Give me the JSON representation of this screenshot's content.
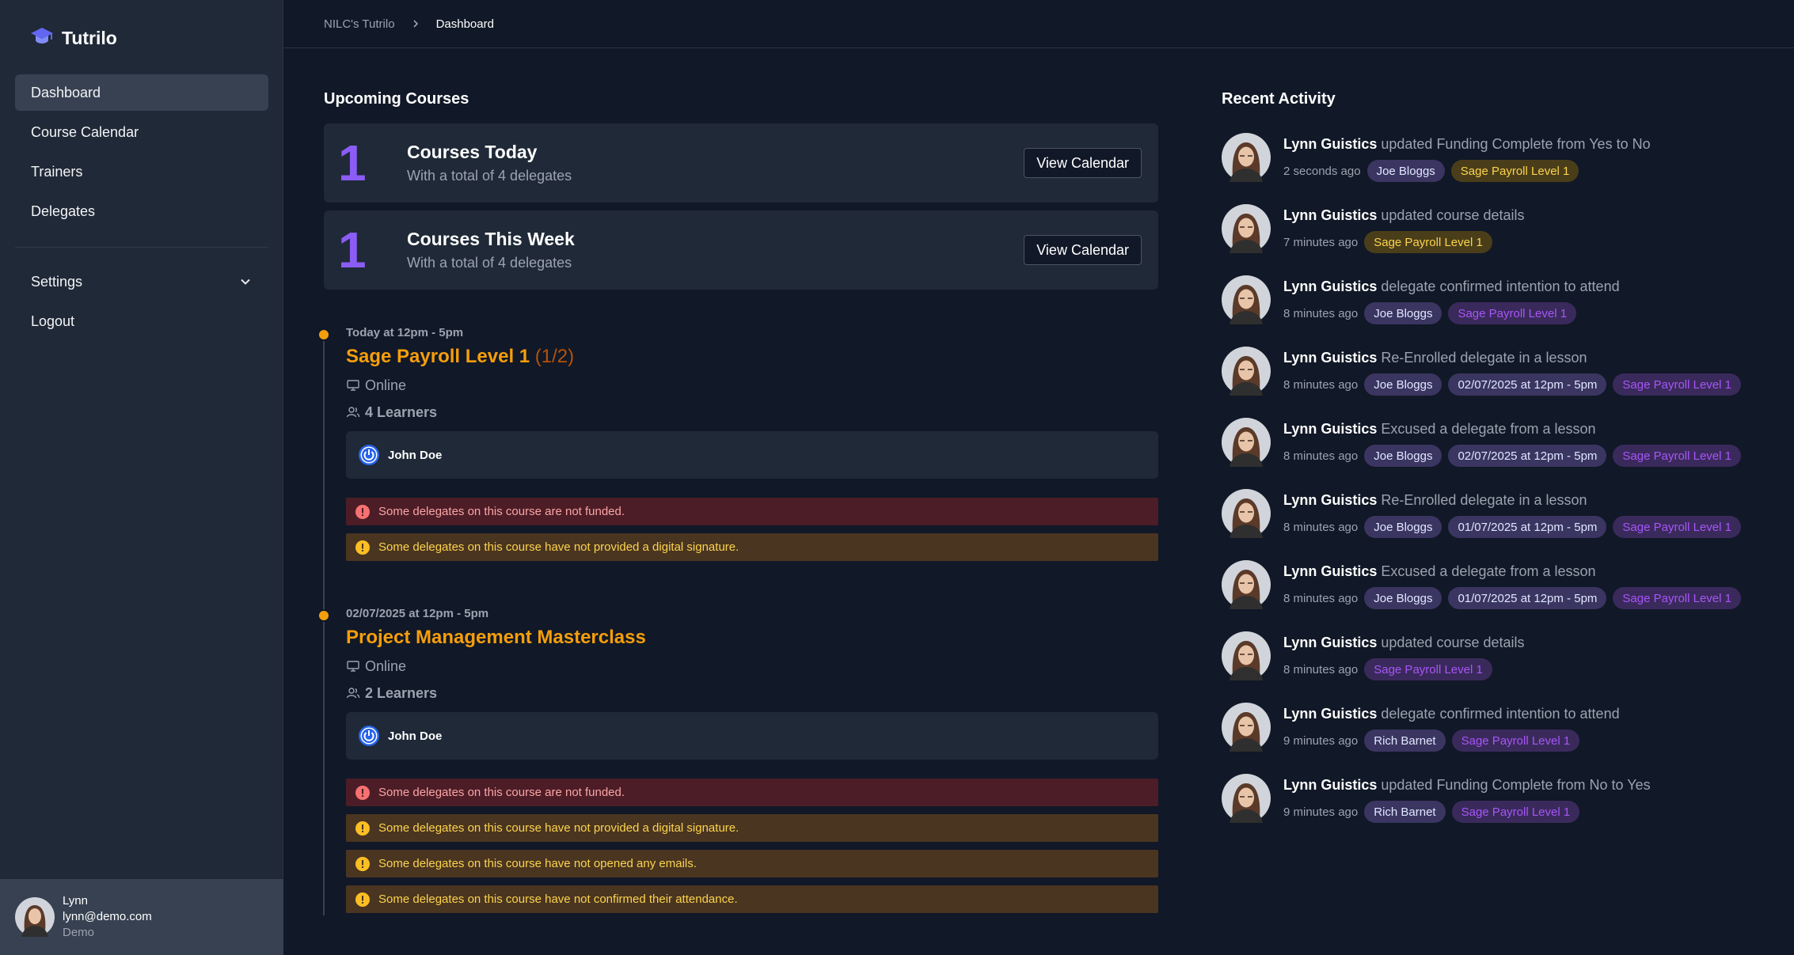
{
  "app": {
    "name": "Tutrilo"
  },
  "sidebar": {
    "items": [
      {
        "label": "Dashboard",
        "active": true
      },
      {
        "label": "Course Calendar"
      },
      {
        "label": "Trainers"
      },
      {
        "label": "Delegates"
      }
    ],
    "settings_label": "Settings",
    "logout_label": "Logout",
    "user": {
      "name": "Lynn",
      "email": "lynn@demo.com",
      "org": "Demo"
    }
  },
  "breadcrumb": {
    "root": "NILC's Tutrilo",
    "current": "Dashboard"
  },
  "upcoming": {
    "title": "Upcoming Courses",
    "cards": [
      {
        "count": "1",
        "title": "Courses Today",
        "subtitle": "With a total of 4 delegates",
        "button": "View Calendar"
      },
      {
        "count": "1",
        "title": "Courses This Week",
        "subtitle": "With a total of 4 delegates",
        "button": "View Calendar"
      }
    ],
    "courses": [
      {
        "time": "Today at 12pm - 5pm",
        "title": "Sage Payroll Level 1",
        "part": "(1/2)",
        "mode": "Online",
        "learners": "4 Learners",
        "trainer": "John Doe",
        "alerts": [
          {
            "type": "red",
            "text": "Some delegates on this course are not funded."
          },
          {
            "type": "amber",
            "text": "Some delegates on this course have not provided a digital signature."
          }
        ]
      },
      {
        "time": "02/07/2025 at 12pm - 5pm",
        "title": "Project Management Masterclass",
        "part": "",
        "mode": "Online",
        "learners": "2 Learners",
        "trainer": "John Doe",
        "alerts": [
          {
            "type": "red",
            "text": "Some delegates on this course are not funded."
          },
          {
            "type": "amber",
            "text": "Some delegates on this course have not provided a digital signature."
          },
          {
            "type": "amber",
            "text": "Some delegates on this course have not opened any emails."
          },
          {
            "type": "amber",
            "text": "Some delegates on this course have not confirmed their attendance."
          }
        ]
      }
    ]
  },
  "activity": {
    "title": "Recent Activity",
    "items": [
      {
        "who": "Lynn Guistics",
        "action": "updated Funding Complete from Yes to No",
        "time": "2 seconds ago",
        "tags": [
          {
            "kind": "user",
            "text": "Joe Bloggs"
          },
          {
            "kind": "course-y",
            "text": "Sage Payroll Level 1"
          }
        ]
      },
      {
        "who": "Lynn Guistics",
        "action": "updated course details",
        "time": "7 minutes ago",
        "tags": [
          {
            "kind": "course-y",
            "text": "Sage Payroll Level 1"
          }
        ]
      },
      {
        "who": "Lynn Guistics",
        "action": "delegate confirmed intention to attend",
        "time": "8 minutes ago",
        "tags": [
          {
            "kind": "user",
            "text": "Joe Bloggs"
          },
          {
            "kind": "course-p",
            "text": "Sage Payroll Level 1"
          }
        ]
      },
      {
        "who": "Lynn Guistics",
        "action": "Re-Enrolled delegate in a lesson",
        "time": "8 minutes ago",
        "tags": [
          {
            "kind": "user",
            "text": "Joe Bloggs"
          },
          {
            "kind": "date",
            "text": "02/07/2025 at 12pm - 5pm"
          },
          {
            "kind": "course-p",
            "text": "Sage Payroll Level 1"
          }
        ]
      },
      {
        "who": "Lynn Guistics",
        "action": "Excused a delegate from a lesson",
        "time": "8 minutes ago",
        "tags": [
          {
            "kind": "user",
            "text": "Joe Bloggs"
          },
          {
            "kind": "date",
            "text": "02/07/2025 at 12pm - 5pm"
          },
          {
            "kind": "course-p",
            "text": "Sage Payroll Level 1"
          }
        ]
      },
      {
        "who": "Lynn Guistics",
        "action": "Re-Enrolled delegate in a lesson",
        "time": "8 minutes ago",
        "tags": [
          {
            "kind": "user",
            "text": "Joe Bloggs"
          },
          {
            "kind": "date",
            "text": "01/07/2025 at 12pm - 5pm"
          },
          {
            "kind": "course-p",
            "text": "Sage Payroll Level 1"
          }
        ]
      },
      {
        "who": "Lynn Guistics",
        "action": "Excused a delegate from a lesson",
        "time": "8 minutes ago",
        "tags": [
          {
            "kind": "user",
            "text": "Joe Bloggs"
          },
          {
            "kind": "date",
            "text": "01/07/2025 at 12pm - 5pm"
          },
          {
            "kind": "course-p",
            "text": "Sage Payroll Level 1"
          }
        ]
      },
      {
        "who": "Lynn Guistics",
        "action": "updated course details",
        "time": "8 minutes ago",
        "tags": [
          {
            "kind": "course-p",
            "text": "Sage Payroll Level 1"
          }
        ]
      },
      {
        "who": "Lynn Guistics",
        "action": "delegate confirmed intention to attend",
        "time": "9 minutes ago",
        "tags": [
          {
            "kind": "user",
            "text": "Rich Barnet"
          },
          {
            "kind": "course-p",
            "text": "Sage Payroll Level 1"
          }
        ]
      },
      {
        "who": "Lynn Guistics",
        "action": "updated Funding Complete from No to Yes",
        "time": "9 minutes ago",
        "tags": [
          {
            "kind": "user",
            "text": "Rich Barnet"
          },
          {
            "kind": "course-p",
            "text": "Sage Payroll Level 1"
          }
        ]
      }
    ]
  },
  "colors": {
    "accent": "#8b5cf6",
    "course": "#f59e0b",
    "bg": "#111827",
    "panel": "#1f2937"
  }
}
